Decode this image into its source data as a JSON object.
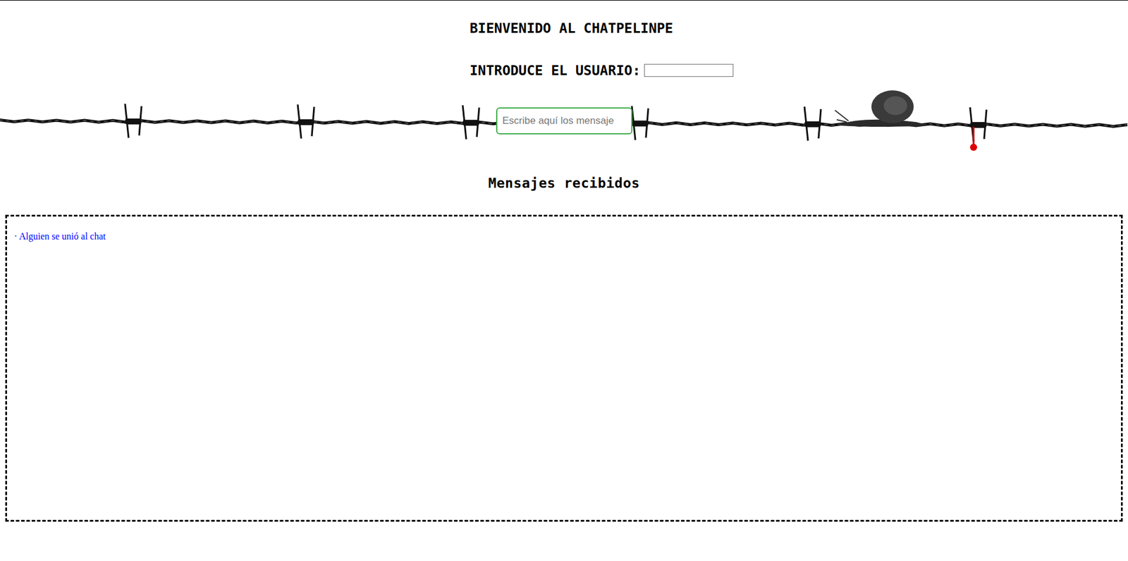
{
  "title": "BIENVENIDO AL CHATPELINPE",
  "user": {
    "label": "INTRODUCE EL USUARIO:",
    "value": ""
  },
  "message_input": {
    "placeholder": "Escribe aquí los mensaje",
    "value": ""
  },
  "messages_title": "Mensajes recibidos",
  "messages": [
    {
      "bullet": "·",
      "text": "Alguien se unió al chat",
      "kind": "system"
    }
  ]
}
